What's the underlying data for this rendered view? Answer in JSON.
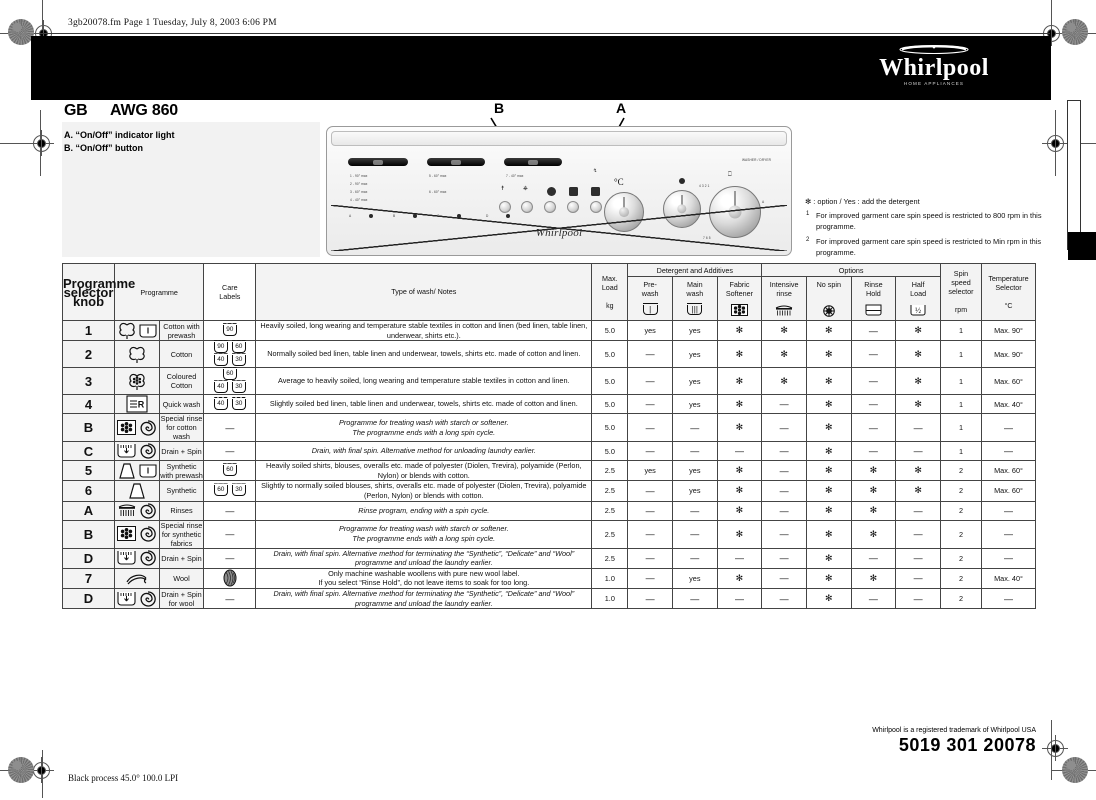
{
  "header": {
    "slug": "3gb20078.fm  Page 1  Tuesday, July 8, 2003  6:06 PM",
    "brand": "Whirlpool",
    "brand_tagline": "HOME   APPLIANCES"
  },
  "title": {
    "country_code": "GB",
    "model": "AWG 860"
  },
  "legend": {
    "a": "A. “On/Off” indicator light",
    "b": "B. “On/Off” button"
  },
  "pointers": {
    "a": "A",
    "b": "B"
  },
  "control_panel": {
    "display_label": "WASHER / DRYER",
    "watermark": "Whirlpool",
    "temp_symbol": "°C",
    "indicator_symbol": "↯",
    "group_labels": [
      "cotton-group",
      "synthetic-group",
      "wool-group"
    ],
    "programme_lines": [
      "1 - 90° max",
      "2 - 90° max",
      "3 - 60° max",
      "4 - 40° max",
      "5 - 60° max",
      "6 - 60° max",
      "7 - 40° max"
    ],
    "letter_lines": [
      "A",
      "B",
      "C",
      "D"
    ]
  },
  "notes": {
    "option_line": "✻ : option /  Yes : add the detergent",
    "footnote_1_marker": "1",
    "footnote_1": "For improved garment care spin speed is restricted to 800 rpm in this programme.",
    "footnote_2_marker": "2",
    "footnote_2": "For improved garment care spin speed is restricted to Min rpm in this programme."
  },
  "table": {
    "headers": {
      "knob": "Programme selector knob",
      "knob_l1": "Programme",
      "knob_l2": "selector",
      "knob_l3": "knob",
      "programme": "Programme",
      "care_l1": "Care",
      "care_l2": "Labels",
      "type": "Type of wash/ Notes",
      "maxload_l1": "Max.",
      "maxload_l2": "Load",
      "maxload_unit": "kg",
      "detergent_group": "Detergent and Additives",
      "prewash_l1": "Pre-",
      "prewash_l2": "wash",
      "mainwash_l1": "Main",
      "mainwash_l2": "wash",
      "softener_l1": "Fabric",
      "softener_l2": "Softener",
      "options_group": "Options",
      "intensive_l1": "Intensive",
      "intensive_l2": "rinse",
      "nospin": "No spin",
      "rinsehold_l1": "Rinse",
      "rinsehold_l2": "Hold",
      "halfload_l1": "Half",
      "halfload_l2": "Load",
      "spin_l1": "Spin",
      "spin_l2": "speed",
      "spin_l3": "selector",
      "spin_unit": "rpm",
      "temp_l1": "Temperature",
      "temp_l2": "Selector",
      "temp_unit": "°C"
    },
    "rows": [
      {
        "knob": "1",
        "icons": "cotton-flower prewash-tub",
        "programme": "Cotton with prewash",
        "care": [
          "90"
        ],
        "care_layout": "single",
        "desc": "Heavily soiled, long wearing and temperature stable textiles in cotton and linen (bed linen, table linen, underwear, shirts etc.).",
        "italic": false,
        "load": "5.0",
        "prewash": "yes",
        "mainwash": "yes",
        "softener": "✻",
        "intensive": "✻",
        "nospin": "✻",
        "rinsehold": "—",
        "halfload": "✻",
        "spin": "1",
        "temp": "Max. 90°"
      },
      {
        "knob": "2",
        "icons": "cotton-flower",
        "programme": "Cotton",
        "care": [
          "90",
          "60",
          "40",
          "30"
        ],
        "care_layout": "grid",
        "desc": "Normally soiled bed linen, table linen and underwear, towels, shirts etc. made of cotton and linen.",
        "italic": false,
        "load": "5.0",
        "prewash": "—",
        "mainwash": "yes",
        "softener": "✻",
        "intensive": "✻",
        "nospin": "✻",
        "rinsehold": "—",
        "halfload": "✻",
        "spin": "1",
        "temp": "Max. 90°"
      },
      {
        "knob": "3",
        "icons": "coloured-cotton-flower",
        "programme": "Coloured Cotton",
        "care": [
          "60",
          "40",
          "30"
        ],
        "care_layout": "grid3",
        "desc": "Average to heavily soiled, long wearing and temperature stable textiles in cotton and linen.",
        "italic": false,
        "load": "5.0",
        "prewash": "—",
        "mainwash": "yes",
        "softener": "✻",
        "intensive": "✻",
        "nospin": "✻",
        "rinsehold": "—",
        "halfload": "✻",
        "spin": "1",
        "temp": "Max. 60°"
      },
      {
        "knob": "4",
        "icons": "quick-wash-R",
        "programme": "Quick wash",
        "care": [
          "40",
          "30"
        ],
        "care_layout": "single",
        "desc": "Slightly soiled bed linen, table linen and underwear, towels, shirts etc. made of cotton and linen.",
        "italic": false,
        "load": "5.0",
        "prewash": "—",
        "mainwash": "yes",
        "softener": "✻",
        "intensive": "—",
        "nospin": "✻",
        "rinsehold": "—",
        "halfload": "✻",
        "spin": "1",
        "temp": "Max. 40°"
      },
      {
        "knob": "B",
        "icons": "softener-tub spiral",
        "programme": "Special rinse for cotton wash",
        "care": [],
        "care_layout": "dash",
        "desc": "Programme for treating wash with starch or softener.\nThe programme ends with a long spin cycle.",
        "italic": true,
        "load": "5.0",
        "prewash": "—",
        "mainwash": "—",
        "softener": "✻",
        "intensive": "—",
        "nospin": "✻",
        "rinsehold": "—",
        "halfload": "—",
        "spin": "1",
        "temp": "—"
      },
      {
        "knob": "C",
        "icons": "drain-tub spiral",
        "programme": "Drain + Spin",
        "care": [],
        "care_layout": "dash",
        "desc": "Drain, with final spin. Alternative method for unloading laundry earlier.",
        "italic": true,
        "load": "5.0",
        "prewash": "—",
        "mainwash": "—",
        "softener": "—",
        "intensive": "—",
        "nospin": "✻",
        "rinsehold": "—",
        "halfload": "—",
        "spin": "1",
        "temp": "—"
      },
      {
        "knob": "5",
        "icons": "synthetic-flask prewash-tub",
        "programme": "Synthetic with prewash",
        "care": [
          "60"
        ],
        "care_layout": "single",
        "desc": "Heavily soiled shirts, blouses, overalls etc. made of polyester (Diolen, Trevira), polyamide (Perlon, Nylon) or blends with cotton.",
        "italic": false,
        "load": "2.5",
        "prewash": "yes",
        "mainwash": "yes",
        "softener": "✻",
        "intensive": "—",
        "nospin": "✻",
        "rinsehold": "✻",
        "halfload": "✻",
        "spin": "2",
        "temp": "Max. 60°"
      },
      {
        "knob": "6",
        "icons": "synthetic-flask",
        "programme": "Synthetic",
        "care": [
          "60",
          "30"
        ],
        "care_layout": "single",
        "desc": "Slightly to normally soiled blouses, shirts, overalls etc. made of polyester (Diolen, Trevira), polyamide (Perlon, Nylon) or blends with cotton.",
        "italic": false,
        "load": "2.5",
        "prewash": "—",
        "mainwash": "yes",
        "softener": "✻",
        "intensive": "—",
        "nospin": "✻",
        "rinsehold": "✻",
        "halfload": "✻",
        "spin": "2",
        "temp": "Max. 60°"
      },
      {
        "knob": "A",
        "icons": "shower spiral",
        "programme": "Rinses",
        "care": [],
        "care_layout": "dash",
        "desc": "Rinse program, ending with a spin cycle.",
        "italic": true,
        "load": "2.5",
        "prewash": "—",
        "mainwash": "—",
        "softener": "✻",
        "intensive": "—",
        "nospin": "✻",
        "rinsehold": "✻",
        "halfload": "—",
        "spin": "2",
        "temp": "—"
      },
      {
        "knob": "B",
        "icons": "softener-tub spiral",
        "programme": "Special rinse for synthetic fabrics",
        "care": [],
        "care_layout": "dash",
        "desc": "Programme for treating wash with starch or softener.\nThe programme ends with a long spin cycle.",
        "italic": true,
        "load": "2.5",
        "prewash": "—",
        "mainwash": "—",
        "softener": "✻",
        "intensive": "—",
        "nospin": "✻",
        "rinsehold": "✻",
        "halfload": "—",
        "spin": "2",
        "temp": "—"
      },
      {
        "knob": "D",
        "icons": "drain-tub spiral",
        "programme": "Drain + Spin",
        "care": [],
        "care_layout": "dash",
        "desc": "Drain, with final spin. Alternative method for terminating the “Synthetic”, “Delicate” and “Wool” programme and unload the laundry earlier.",
        "italic": true,
        "load": "2.5",
        "prewash": "—",
        "mainwash": "—",
        "softener": "—",
        "intensive": "—",
        "nospin": "✻",
        "rinsehold": "—",
        "halfload": "—",
        "spin": "2",
        "temp": "—"
      },
      {
        "knob": "7",
        "icons": "wool-skein",
        "programme": "Wool",
        "care": [
          "wool"
        ],
        "care_layout": "wool",
        "desc": "Only machine washable woollens with pure new wool label.\nIf you select “Rinse Hold”, do not leave items to soak for too long.",
        "italic": false,
        "load": "1.0",
        "prewash": "—",
        "mainwash": "yes",
        "softener": "✻",
        "intensive": "—",
        "nospin": "✻",
        "rinsehold": "✻",
        "halfload": "—",
        "spin": "2",
        "temp": "Max. 40°"
      },
      {
        "knob": "D",
        "icons": "drain-tub spiral",
        "programme": "Drain + Spin for wool",
        "care": [],
        "care_layout": "dash",
        "desc": "Drain, with final spin. Alternative method for terminating the “Synthetic”, “Delicate” and “Wool” programme and unload the laundry earlier.",
        "italic": true,
        "load": "1.0",
        "prewash": "—",
        "mainwash": "—",
        "softener": "—",
        "intensive": "—",
        "nospin": "✻",
        "rinsehold": "—",
        "halfload": "—",
        "spin": "2",
        "temp": "—"
      }
    ]
  },
  "footer": {
    "trademark": "Whirlpool is a registered trademark of  Whirlpool USA",
    "code": "5019 301 20078",
    "process": "Black process 45.0° 100.0 LPI"
  },
  "colors": {
    "banner": "#000000",
    "panel_grey": "#f2f2f2",
    "header_grey": "#f3f3f3",
    "rule": "#444444"
  }
}
